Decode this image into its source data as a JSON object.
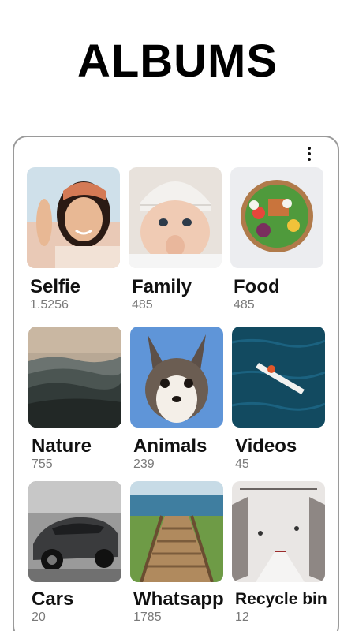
{
  "header": {
    "title": "ALBUMS"
  },
  "menu": {
    "icon": "more-vertical-icon"
  },
  "albums": [
    {
      "name": "Selfie",
      "count": "1.5256",
      "thumb": "selfie-photo"
    },
    {
      "name": "Family",
      "count": "485",
      "thumb": "baby-photo"
    },
    {
      "name": "Food",
      "count": "485",
      "thumb": "salad-bowl-photo"
    },
    {
      "name": "Nature",
      "count": "755",
      "thumb": "mountains-photo"
    },
    {
      "name": "Animals",
      "count": "239",
      "thumb": "puppy-photo"
    },
    {
      "name": "Videos",
      "count": "45",
      "thumb": "ocean-paddleboard-photo"
    },
    {
      "name": "Cars",
      "count": "20",
      "thumb": "sports-car-photo"
    },
    {
      "name": "Whatsapp",
      "count": "1785",
      "thumb": "wooden-stairs-photo"
    },
    {
      "name": "Recycle bin",
      "count": "12",
      "thumb": "snowy-street-photo"
    }
  ]
}
